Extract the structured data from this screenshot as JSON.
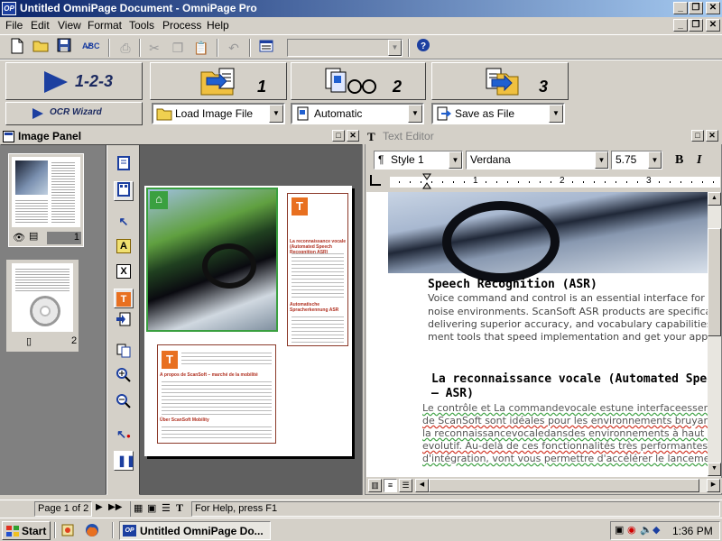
{
  "window": {
    "app_icon_text": "OP",
    "title": "Untitled OmniPage Document - OmniPage Pro"
  },
  "menu": [
    "File",
    "Edit",
    "View",
    "Format",
    "Tools",
    "Process",
    "Help"
  ],
  "toolbar": {
    "spell_label": "ABC",
    "combo_value": ""
  },
  "wizard": {
    "btn123_label": "1-2-3",
    "ocr_wizard_label": "OCR Wizard",
    "step1_number": "1",
    "step2_number": "2",
    "step3_number": "3",
    "load_dropdown": "Load Image File",
    "auto_dropdown": "Automatic",
    "save_dropdown": "Save as File"
  },
  "image_panel": {
    "title": "Image Panel",
    "thumb1_number": "1",
    "thumb2_number": "2",
    "page_heading_fr": "La reconnaissance vocale (Automated Speech Recognition ASR)",
    "page_heading_de": "Automatische Spracherkennung ASR",
    "page_heading_bottom": "A propos de ScanSoft – marché de la mobilité",
    "page_heading_bottom2": "Über ScanSoft Mobility"
  },
  "text_editor": {
    "title": "Text Editor",
    "style_value": "Style 1",
    "font_value": "Verdana",
    "size_value": "5.75",
    "bold_label": "B",
    "italic_label": "I",
    "ruler_marks": [
      "1",
      "2",
      "3"
    ],
    "heading1": "Speech Recognition (ASR)",
    "para1": [
      "Voice command and control is an essential interface for hands-free mobile appl",
      "noise environments. ScanSoft ASR products are specifically to over",
      "delivering superior accuracy, and vocabulary capabilities to your applications. I",
      "ment tools that speed implementation and get your applications to market"
    ],
    "heading2_line1": "La reconnaissance vocale (Automated Speech R",
    "heading2_line2": "– ASR)",
    "para2": [
      "Le contrôle et La commandevocale estune interfaceessentielle pourles application",
      "de ScanSoft sont idéales pour les environnements bruyants. Les solutions ASR c",
      "la reconnaissancevocaledansdes environnements à haut niveau de bruit, pe",
      "evolutif. Au-delà de ces fonctionnalités très performantes, ScanSoft fourni",
      "d'intégration, vont vous permettre d'accélérer le lancement de vos applicatio"
    ]
  },
  "status": {
    "page_indicator": "Page 1 of 2",
    "help_text": "For Help, press F1"
  },
  "taskbar": {
    "start_label": "Start",
    "task_label": "Untitled OmniPage Do...",
    "clock": "1:36 PM"
  }
}
